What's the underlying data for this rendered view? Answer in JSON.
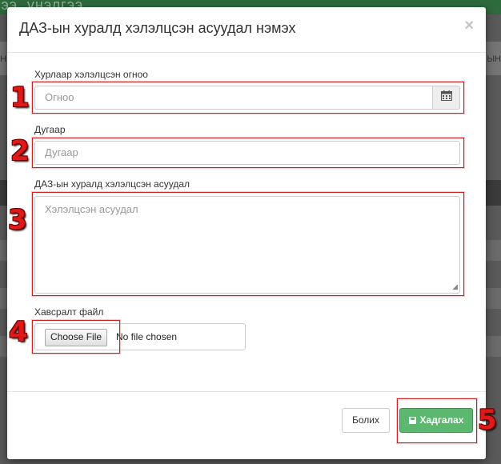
{
  "background": {
    "top_text": "гээ, үнэлгээ",
    "left_text": "НЭ",
    "right_text": "ЫН"
  },
  "modal": {
    "title": "ДАЗ-ын хуралд хэлэлцсэн асуудал нэмэх",
    "close_icon": "×"
  },
  "fields": {
    "date_label": "Хурлаар хэлэлцсэн огноо",
    "date_placeholder": "Огноо",
    "date_icon": "calendar-icon",
    "number_label": "Дугаар",
    "number_placeholder": "Дугаар",
    "issue_label": "ДАЗ-ын хуралд хэлэлцсэн асуудал",
    "issue_placeholder": "Хэлэлцсэн асуудал",
    "file_label": "Хавсралт файл",
    "file_button": "Choose File",
    "file_status": "No file chosen"
  },
  "footer": {
    "cancel_label": "Болих",
    "save_label": "Хадгалах",
    "save_icon": "floppy-disk-icon"
  },
  "annotations": [
    "1",
    "2",
    "3",
    "4",
    "5"
  ],
  "colors": {
    "annotation_red": "#e01818",
    "save_green": "#5cb86e"
  }
}
